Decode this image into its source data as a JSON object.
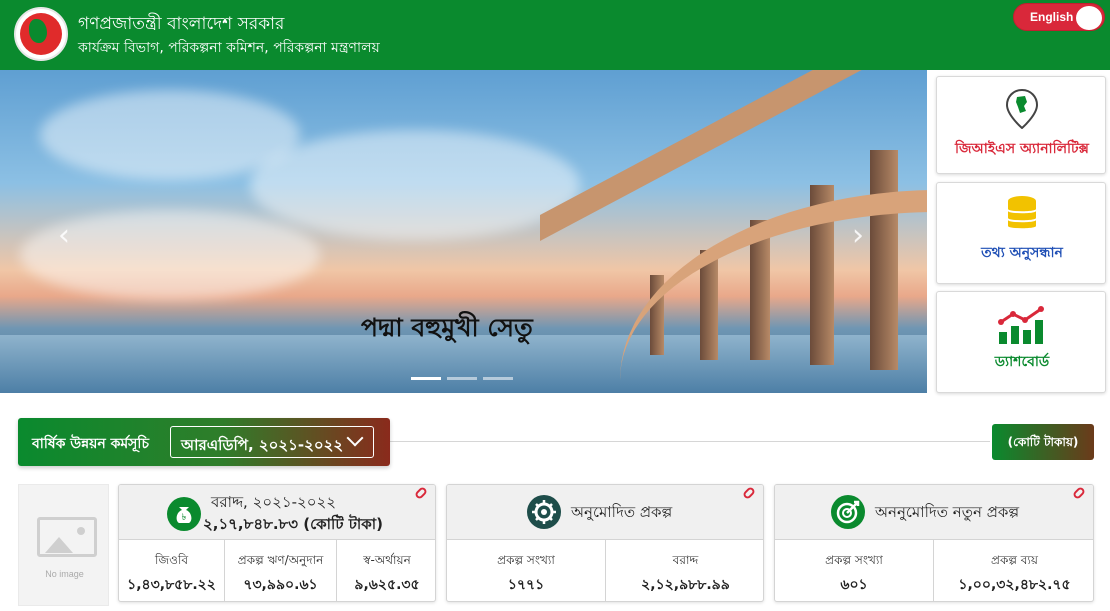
{
  "header": {
    "title": "গণপ্রজাতন্ত্রী বাংলাদেশ সরকার",
    "subtitle": "কার্যক্রম বিভাগ, পরিকল্পনা কমিশন, পরিকল্পনা মন্ত্রণালয়",
    "language_toggle": "English",
    "colors": {
      "brand_green": "#0a8a2e",
      "accent_red": "#d9283a"
    }
  },
  "hero": {
    "caption": "পদ্মা বহুমুখী সেতু",
    "prev_icon": "chevron-left-icon",
    "next_icon": "chevron-right-icon",
    "slides_total": 3,
    "active_slide": 1
  },
  "side_cards": [
    {
      "label": "জিআইএস অ্যানালিটিক্স",
      "icon": "map-pin-icon",
      "color": "#d9283a"
    },
    {
      "label": "তথ্য অনুসন্ধান",
      "icon": "database-icon",
      "color": "#1f4fb5"
    },
    {
      "label": "ড্যাশবোর্ড",
      "icon": "chart-icon",
      "color": "#0a8a2e"
    }
  ],
  "adp": {
    "label": "বার্ষিক উন্নয়ন কর্মসূচি",
    "selected": "আরএডিপি, ২০২১-২০২২",
    "unit": "(কোটি টাকায়)"
  },
  "no_image": "No image",
  "stats": {
    "allocation": {
      "title": "বরাদ্দ, ২০২১-২০২২",
      "value": "২,১৭,৮৪৮.৮৩ (কোটি টাকা)",
      "icon": "taka-bag-icon",
      "cells": [
        {
          "label": "জিওবি",
          "value": "১,৪৩,৮৫৮.২২"
        },
        {
          "label": "প্রকল্প ঋণ/অনুদান",
          "value": "৭৩,৯৯০.৬১"
        },
        {
          "label": "স্ব-অর্থায়ন",
          "value": "৯,৬২৫.৩৫"
        }
      ]
    },
    "approved": {
      "title": "অনুমোদিত প্রকল্প",
      "icon": "gear-icon",
      "cells": [
        {
          "label": "প্রকল্প সংখ্যা",
          "value": "১৭৭১"
        },
        {
          "label": "বরাদ্দ",
          "value": "২,১২,৯৮৮.৯৯"
        }
      ]
    },
    "unapproved": {
      "title": "অননুমোদিত নতুন প্রকল্প",
      "icon": "target-icon",
      "cells": [
        {
          "label": "প্রকল্প সংখ্যা",
          "value": "৬০১"
        },
        {
          "label": "প্রকল্প ব্যয়",
          "value": "১,০০,৩২,৪৮২.৭৫"
        }
      ]
    }
  }
}
